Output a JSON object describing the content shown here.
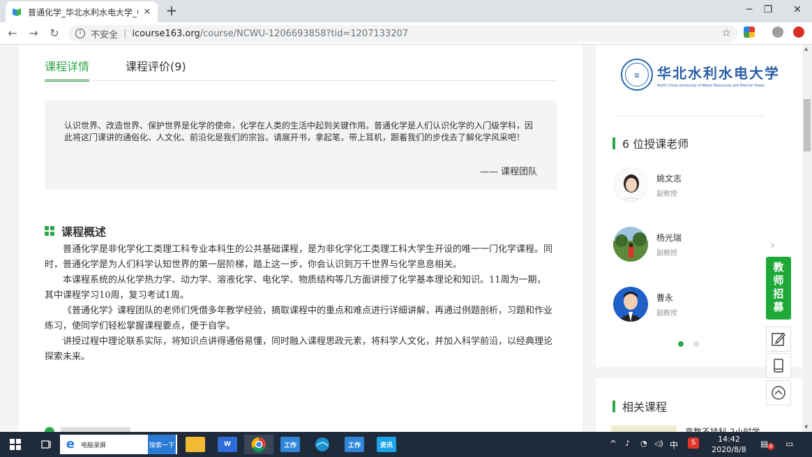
{
  "browser": {
    "tab_title": "普通化学_华北水利水电大学_中国",
    "new_tab_label": "+",
    "security_label": "不安全",
    "separator": "|",
    "url_host": "icourse163.org",
    "url_path": "/course/NCWU-1206693858?tid=1207133207",
    "controls": {
      "minimize": "─",
      "maximize": "❐",
      "close": "✕",
      "tab_close": "✕",
      "back": "←",
      "forward": "→",
      "reload": "↻",
      "bookmark": "☆"
    },
    "icons": [
      "tab-favicon-icon",
      "info-icon",
      "star-icon",
      "extension-icon",
      "profile-icon",
      "update-icon"
    ]
  },
  "course": {
    "tabs": [
      {
        "label": "课程详情",
        "active": true
      },
      {
        "label": "课程评价(9)",
        "active": false
      }
    ],
    "quote": {
      "text": "认识世界、改造世界、保护世界是化学的使命，化学在人类的生活中起到关键作用。普通化学是人们认识化学的入门级学科，因此将这门课讲的通俗化、人文化、前沿化是我们的宗旨。请展开书，拿起笔，带上耳机，跟着我们的步伐去了解化学风采吧！",
      "signature": "—— 课程团队"
    },
    "overview_title": "课程概述",
    "overview_paragraphs": [
      "普通化学是非化学化工类理工科专业本科生的公共基础课程，是为非化学化工类理工科大学生开设的唯一一门化学课程。同时，普通化学是为人们科学认知世界的第一层阶梯，踏上这一步，你会认识到万千世界与化学息息相关。",
      "本课程系统的从化学热力学、动力学、溶液化学、电化学、物质结构等几方面讲授了化学基本理论和知识。11周为一期，其中课程学习10周，复习考试1周。",
      "《普通化学》课程团队的老师们凭借多年教学经验，摘取课程中的重点和难点进行详细讲解，再通过例题剖析，习题和作业练习，使同学们轻松掌握课程要点，便于自学。",
      "讲授过程中理论联系实际，将知识点讲得通俗易懂，同时融入课程思政元素，将科学人文化，并加入科学前沿，以经典理论探索未来。"
    ]
  },
  "sidebar": {
    "university_name": "华北水利水电大学",
    "university_en": "North China University of Water Resources and Electric Power",
    "teachers_title": "6 位授课老师",
    "teachers": [
      {
        "name": "姚文志",
        "title": "副教授"
      },
      {
        "name": "杨光瑞",
        "title": "副教授"
      },
      {
        "name": "曹永",
        "title": "副教授"
      }
    ],
    "next_arrow": "›",
    "related_title": "相关课程",
    "related_first": "高数不挂科 2小时学"
  },
  "floating": {
    "recruit_label": "教师招募",
    "buttons": [
      "edit-icon",
      "mobile-icon",
      "back-to-top-icon"
    ]
  },
  "taskbar": {
    "search_text": "电脑录屏",
    "search_button": "搜索一下",
    "apps": [
      "工作",
      "工作",
      "资讯"
    ],
    "ime": "中",
    "time": "14:42",
    "date": "2020/8/8",
    "notification_count": "8"
  },
  "colors": {
    "accent": "#30a64a",
    "recruit": "#1ea838",
    "taskbar": "#1f2a3a"
  }
}
